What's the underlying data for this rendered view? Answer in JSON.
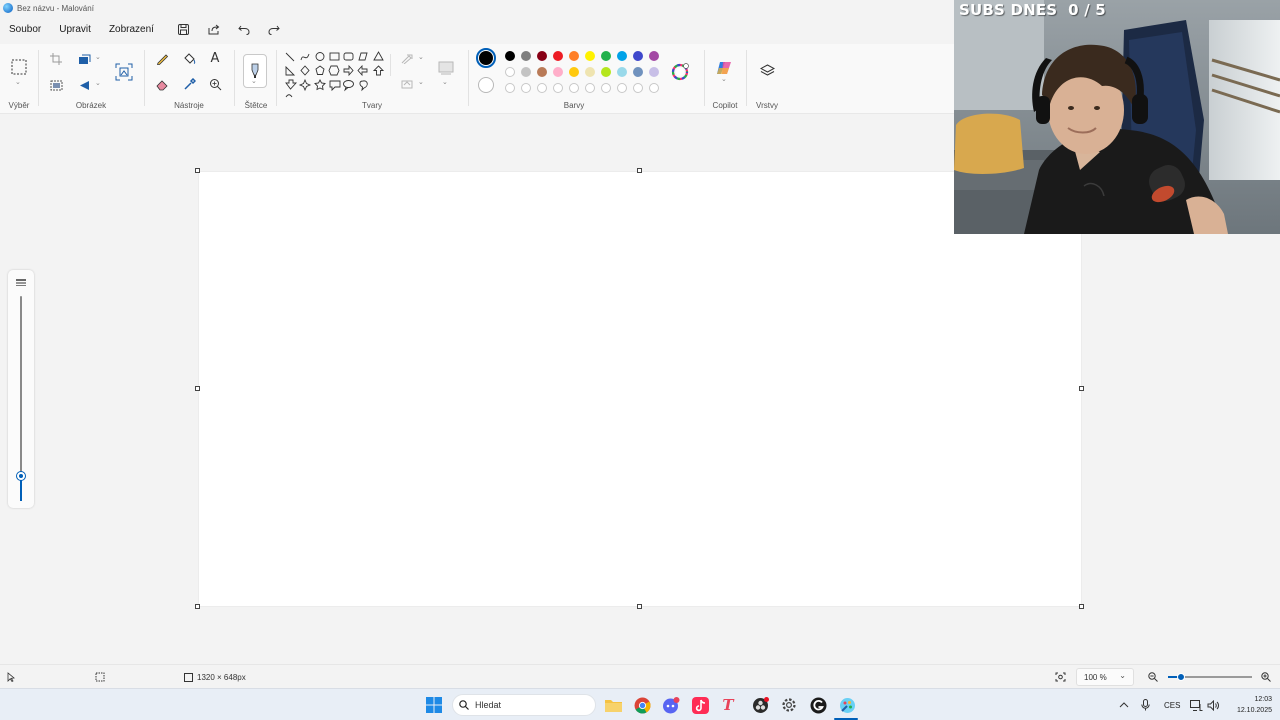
{
  "window": {
    "title": "Bez názvu - Malování"
  },
  "menu": {
    "items": [
      "Soubor",
      "Upravit",
      "Zobrazení"
    ]
  },
  "ribbon": {
    "groups": {
      "selection": "Výběr",
      "image": "Obrázek",
      "tools": "Nástroje",
      "brushes": "Štětce",
      "shapes": "Tvary",
      "colors": "Barvy",
      "copilot": "Copilot",
      "layers": "Vrstvy"
    }
  },
  "palette": {
    "primary": "#000000",
    "secondary": "#ffffff",
    "row1": [
      "#000000",
      "#7f7f7f",
      "#880015",
      "#ed1c24",
      "#ff7f27",
      "#fff200",
      "#22b14c",
      "#00a2e8",
      "#3f48cc",
      "#a349a4"
    ],
    "row2": [
      "#ffffff",
      "#c3c3c3",
      "#b97a57",
      "#ffaec9",
      "#ffc90e",
      "#efe4b0",
      "#b5e61d",
      "#99d9ea",
      "#7092be",
      "#c8bfe7"
    ]
  },
  "status": {
    "canvas_size": "1320 × 648px",
    "zoom": "100 %",
    "brush_size_level": 0.12,
    "zoom_slider_level": 0.15
  },
  "taskbar": {
    "search_placeholder": "Hledat",
    "language": "CES",
    "time": "12:03",
    "date": "12.10.2025"
  },
  "overlay": {
    "subs_text": "SUBS DNES  0 / 5"
  }
}
